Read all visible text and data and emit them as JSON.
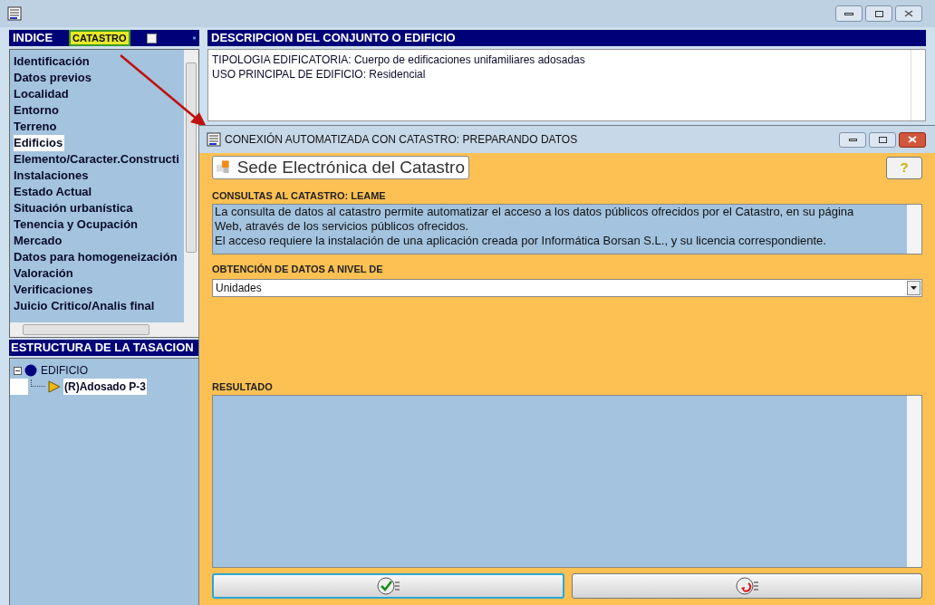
{
  "indice": {
    "title": "INDICE",
    "catastro_button": "CATASTRO",
    "checkbox": {
      "checked": false
    },
    "items": [
      {
        "label": "Identificación",
        "selected": false
      },
      {
        "label": "Datos previos",
        "selected": false
      },
      {
        "label": "Localidad",
        "selected": false
      },
      {
        "label": "Entorno",
        "selected": false
      },
      {
        "label": "Terreno",
        "selected": false
      },
      {
        "label": "Edificios",
        "selected": true
      },
      {
        "label": "Elemento/Caracter.Constructi",
        "selected": false
      },
      {
        "label": "Instalaciones",
        "selected": false
      },
      {
        "label": "Estado Actual",
        "selected": false
      },
      {
        "label": "Situación urbanística",
        "selected": false
      },
      {
        "label": "Tenencia y Ocupación",
        "selected": false
      },
      {
        "label": "Mercado",
        "selected": false
      },
      {
        "label": "Datos para homogeneización",
        "selected": false
      },
      {
        "label": "Valoración",
        "selected": false
      },
      {
        "label": "Verificaciones",
        "selected": false
      },
      {
        "label": "Juicio Critico/Analis final",
        "selected": false
      }
    ]
  },
  "description": {
    "title": "DESCRIPCION DEL CONJUNTO O EDIFICIO",
    "lines": [
      "TIPOLOGIA EDIFICATORIA: Cuerpo de edificaciones unifamiliares adosadas",
      "USO PRINCIPAL DE EDIFICIO: Residencial"
    ]
  },
  "structure": {
    "title": "ESTRUCTURA DE LA TASACION",
    "tree": [
      {
        "label": "EDIFICIO",
        "expanded": true,
        "selected": false,
        "children": [
          {
            "label": "(R)Adosado P-3",
            "selected": true
          }
        ]
      }
    ]
  },
  "dialog": {
    "title": "CONEXIÓN AUTOMATIZADA CON CATASTRO: PREPARANDO DATOS",
    "logo_text": "Sede Electrónica del Catastro",
    "help_button": "?",
    "readme_label": "CONSULTAS AL CATASTRO: LEAME",
    "readme_text": [
      "La consulta de datos al catastro permite automatizar el acceso a los datos públicos ofrecidos por el Catastro, en su página Web, através de los servicios públicos ofrecidos.",
      "El acceso requiere la instalación de una aplicación creada por Informática Borsan S.L., y su licencia correspondiente."
    ],
    "level_label": "OBTENCIÓN DE DATOS A NIVEL DE",
    "level_value": "Unidades",
    "result_label": "RESULTADO",
    "buttons": [
      {
        "kind": "accept",
        "focused": true
      },
      {
        "kind": "cancel",
        "focused": false
      }
    ]
  }
}
